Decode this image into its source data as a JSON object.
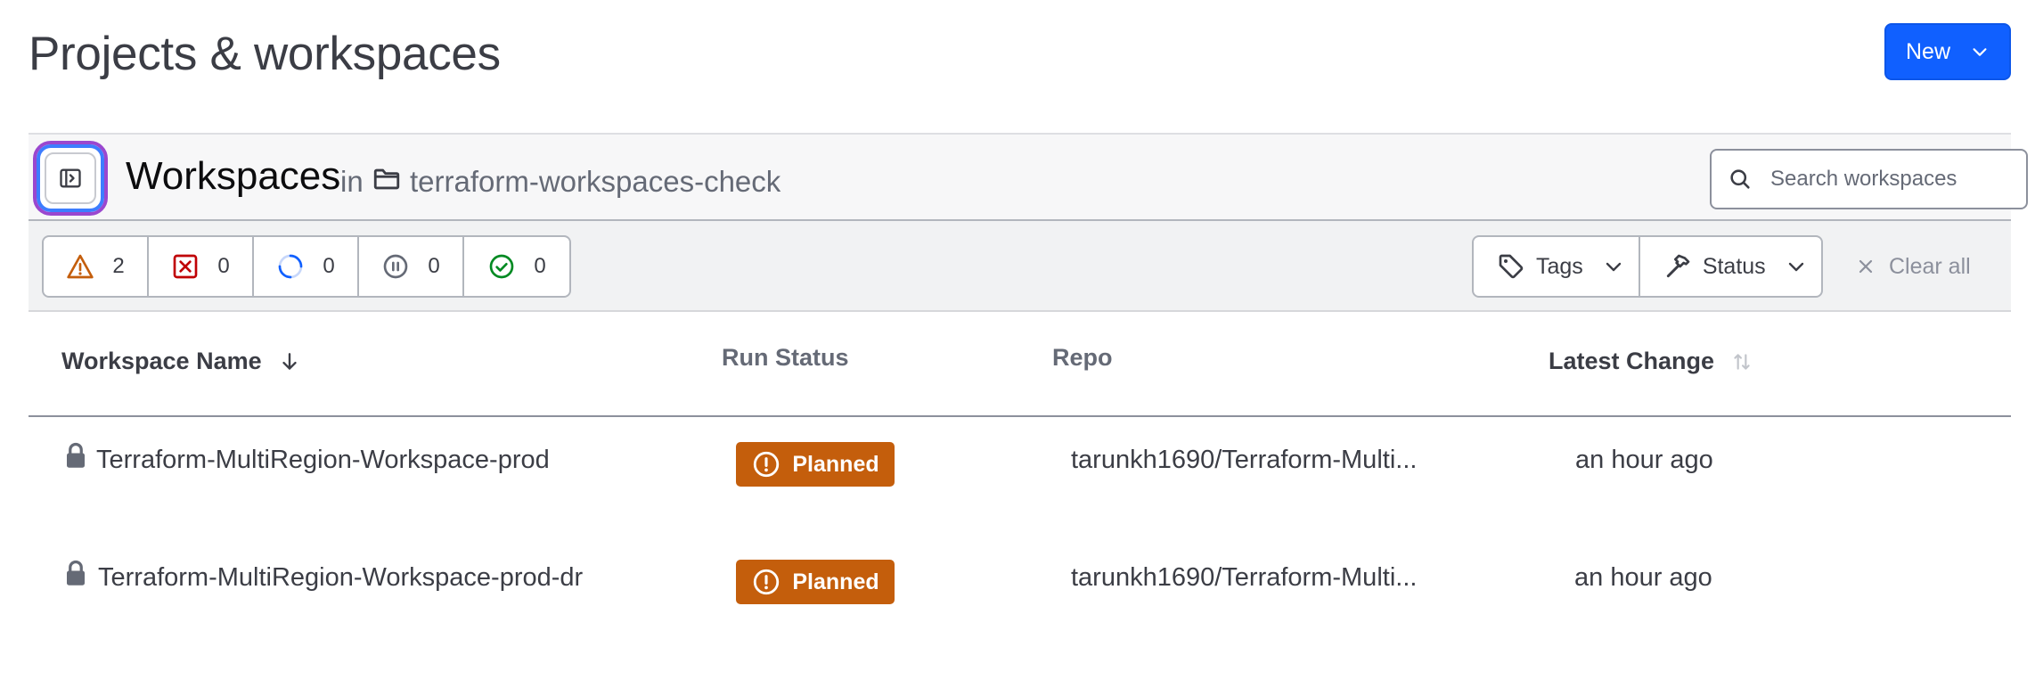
{
  "page": {
    "title": "Projects & workspaces"
  },
  "new_button": {
    "label": "New"
  },
  "workspaces_header": {
    "title": "Workspaces",
    "in_label": "in",
    "folder_name": "terraform-workspaces-check"
  },
  "search": {
    "placeholder": "Search workspaces"
  },
  "status_counts": [
    {
      "icon": "warning-triangle-icon",
      "count": "2",
      "color": "#c45e0c"
    },
    {
      "icon": "error-x-square-icon",
      "count": "0",
      "color": "#c00005"
    },
    {
      "icon": "running-loader-icon",
      "count": "0",
      "color": "#1060ff"
    },
    {
      "icon": "paused-circle-icon",
      "count": "0",
      "color": "#656a76"
    },
    {
      "icon": "success-check-circle-icon",
      "count": "0",
      "color": "#008a22"
    }
  ],
  "filters": {
    "tags_label": "Tags",
    "status_label": "Status",
    "clear_label": "Clear all"
  },
  "table": {
    "columns": [
      "Workspace Name",
      "Run Status",
      "Repo",
      "Latest Change"
    ],
    "rows": [
      {
        "name": "Terraform-MultiRegion-Workspace-prod",
        "run_status": "Planned",
        "repo": "tarunkh1690/Terraform-Multi...",
        "latest_change": "an hour ago"
      },
      {
        "name": "Terraform-MultiRegion-Workspace-prod-dr",
        "run_status": "Planned",
        "repo": "tarunkh1690/Terraform-Multi...",
        "latest_change": "an hour ago"
      }
    ]
  },
  "colors": {
    "primary": "#1060ff",
    "planned_badge": "#c45e0c",
    "text": "#3b3d45",
    "muted": "#656a76"
  }
}
